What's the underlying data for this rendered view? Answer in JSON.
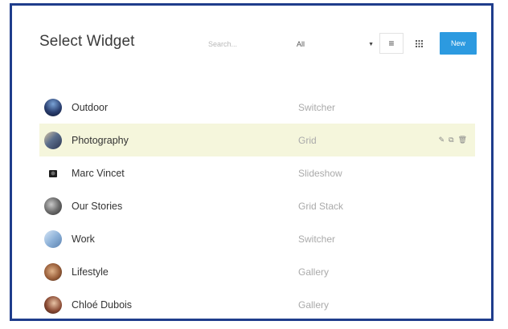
{
  "header": {
    "title": "Select Widget",
    "search_placeholder": "Search...",
    "filter_value": "All",
    "new_label": "New"
  },
  "icons": {
    "list_view": "list-view-icon",
    "grid_view": "grid-view-icon",
    "caret": "caret-down-icon",
    "edit": "pencil-icon",
    "copy": "copy-icon",
    "delete": "trash-icon"
  },
  "colors": {
    "accent": "#2c9ae0",
    "highlight_row": "#f5f6dc",
    "frame": "#1f3d8c"
  },
  "widgets": [
    {
      "name": "Outdoor",
      "type": "Switcher"
    },
    {
      "name": "Photography",
      "type": "Grid"
    },
    {
      "name": "Marc Vincet",
      "type": "Slideshow"
    },
    {
      "name": "Our Stories",
      "type": "Grid Stack"
    },
    {
      "name": "Work",
      "type": "Switcher"
    },
    {
      "name": "Lifestyle",
      "type": "Gallery"
    },
    {
      "name": "Chloé Dubois",
      "type": "Gallery"
    }
  ]
}
